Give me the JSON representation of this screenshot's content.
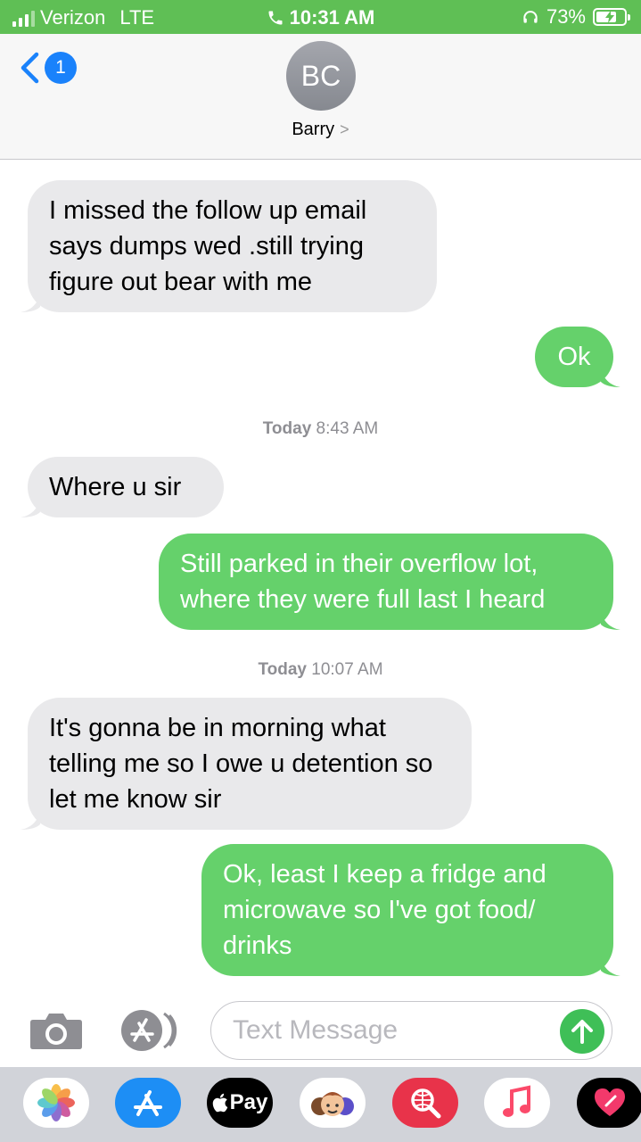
{
  "status_bar": {
    "carrier": "Verizon",
    "network": "LTE",
    "time": "10:31 AM",
    "battery_percent": "73%",
    "battery_level": 0.73
  },
  "header": {
    "unread_count": "1",
    "avatar_initials": "BC",
    "contact_name": "Barry",
    "contact_chevron": ">"
  },
  "thread": {
    "msg1": "I missed the follow up email says dumps wed .still trying figure out bear with me",
    "msg2": "Ok",
    "stamp1": {
      "day": "Today",
      "time": "8:43 AM"
    },
    "msg3": "Where u sir",
    "msg4": "Still parked in their overflow lot, where they were full last I heard",
    "stamp2": {
      "day": "Today",
      "time": "10:07 AM"
    },
    "msg5": "It's gonna be in morning what telling me so I owe u detention so let me know sir",
    "msg6": "Ok, least I keep a fridge and microwave so I've got food/ drinks"
  },
  "composer": {
    "placeholder": "Text Message",
    "camera_icon": "camera-icon",
    "apps_icon": "app-store-icon",
    "send_icon": "arrow-up-icon"
  },
  "app_drawer": {
    "applepay_label": "Pay",
    "apps": [
      "photos-icon",
      "app-store-icon",
      "apple-pay-icon",
      "memoji-icon",
      "web-search-icon",
      "music-icon",
      "digital-touch-icon"
    ]
  },
  "colors": {
    "status_bar": "#5fbf55",
    "incoming_bubble": "#e9e9eb",
    "outgoing_bubble": "#65d16b",
    "ios_blue": "#1a82fb"
  }
}
